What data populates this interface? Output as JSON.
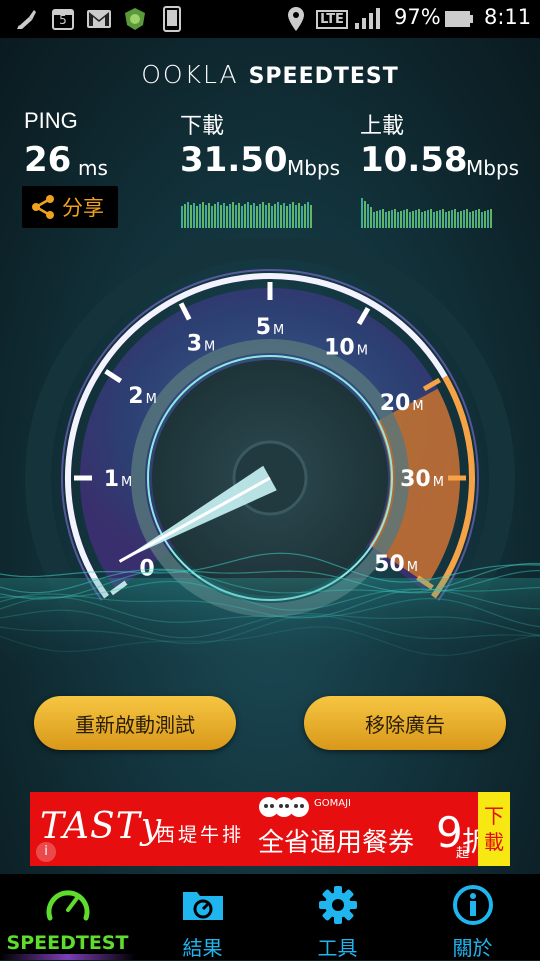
{
  "status_bar": {
    "icons": [
      "broom-icon",
      "calendar-icon",
      "gmail-icon",
      "shield-app-icon",
      "phone-icon",
      "location-icon",
      "lte-icon",
      "signal-icon",
      "battery-icon"
    ],
    "calendar_day": "5",
    "lte": "LTE",
    "battery": "97%",
    "time": "8:11"
  },
  "header": {
    "logo_ookla": "OOKLA",
    "logo_speedtest": "SPEEDTEST"
  },
  "results": {
    "ping_label": "PING",
    "ping_value": "26",
    "ping_unit": "ms",
    "download_label": "下載",
    "download_value": "31.50",
    "download_unit": "Mbps",
    "upload_label": "上載",
    "upload_value": "10.58",
    "upload_unit": "Mbps",
    "share_label": "分享"
  },
  "gauge": {
    "ticks": [
      {
        "num": "0",
        "unit": "",
        "angle": -126
      },
      {
        "num": "1",
        "unit": "M",
        "angle": -90
      },
      {
        "num": "2",
        "unit": "M",
        "angle": -57
      },
      {
        "num": "3",
        "unit": "M",
        "angle": -27
      },
      {
        "num": "5",
        "unit": "M",
        "angle": 0
      },
      {
        "num": "10",
        "unit": "M",
        "angle": 30
      },
      {
        "num": "20",
        "unit": "M",
        "angle": 60
      },
      {
        "num": "30",
        "unit": "M",
        "angle": 90
      },
      {
        "num": "50",
        "unit": "M",
        "angle": 124
      }
    ],
    "needle_angle": -119
  },
  "buttons": {
    "restart": "重新啟動測試",
    "remove_ads": "移除廣告"
  },
  "ad": {
    "tasty": "TASTy",
    "brand": "西堤牛排",
    "offer": "全省通用餐券",
    "nine": "9",
    "zhe": "折",
    "qi": "起",
    "gomaji": "GOMAJI",
    "download": [
      "下",
      "載"
    ],
    "info": "i"
  },
  "nav": {
    "items": [
      {
        "label": "SPEEDTEST",
        "icon": "speedometer-icon",
        "active": true,
        "color": "#5fdc2e"
      },
      {
        "label": "結果",
        "icon": "results-folder-icon",
        "active": false,
        "color": "#1fb6f0"
      },
      {
        "label": "工具",
        "icon": "gear-icon",
        "active": false,
        "color": "#1fb6f0"
      },
      {
        "label": "關於",
        "icon": "info-icon",
        "active": false,
        "color": "#1fb6f0"
      }
    ]
  },
  "colors": {
    "accent_orange": "#f0a21c",
    "nav_active": "#5fdc2e",
    "nav_blue": "#1fb6f0",
    "bar_green": "#7fd36b",
    "bar_teal": "#3fcfb6"
  }
}
